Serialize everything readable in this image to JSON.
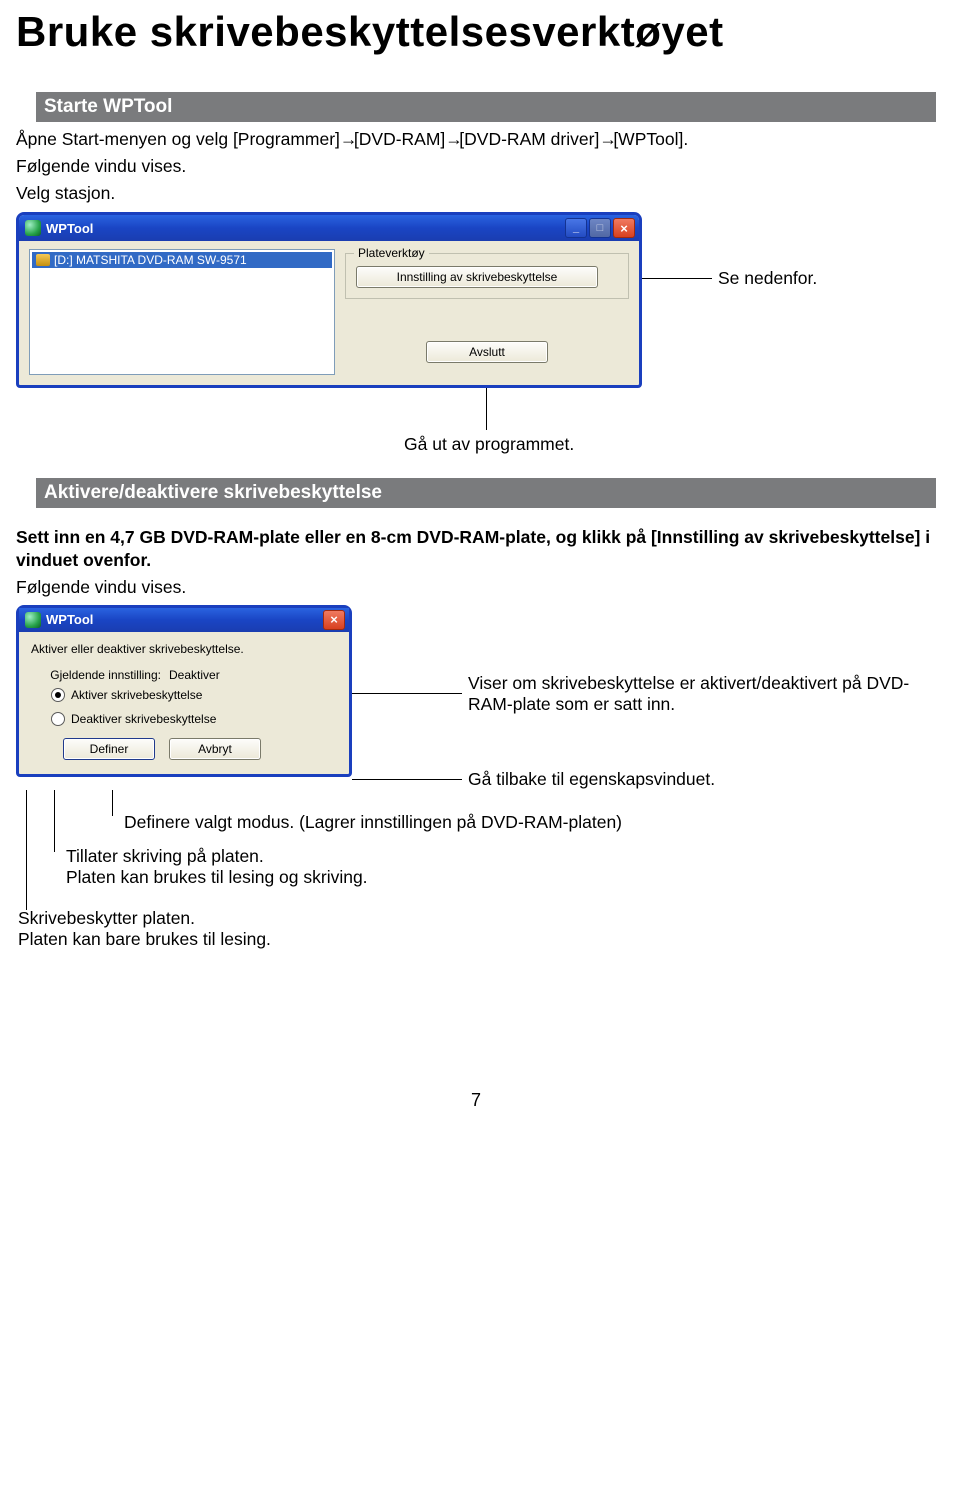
{
  "page_title": "Bruke skrivebeskyttelsesverktøyet",
  "section1_title": "Starte WPTool",
  "open_instructions_prefix": "Åpne Start-menyen og velg ",
  "open_path": [
    "[Programmer]",
    "[DVD-RAM]",
    "[DVD-RAM driver]",
    "[WPTool]"
  ],
  "arrow": "→",
  "period": ".",
  "following_window": "Følgende vindu vises.",
  "select_station": "Velg stasjon.",
  "win1": {
    "title": "WPTool",
    "drive_item": "[D:] MATSHITA DVD-RAM SW-9571",
    "group_label": "Plateverktøy",
    "btn_setting": "Innstilling av skrivebeskyttelse",
    "btn_quit": "Avslutt"
  },
  "callout_see_below": "Se nedenfor.",
  "callout_exit": "Gå ut av programmet.",
  "section2_title": "Aktivere/deaktivere skrivebeskyttelse",
  "section2_para": "Sett inn en 4,7 GB DVD-RAM-plate eller en 8-cm DVD-RAM-plate, og klikk på [Innstilling av skrivebeskyttelse] i vinduet ovenfor.",
  "win2": {
    "title": "WPTool",
    "desc": "Aktiver eller deaktiver skrivebeskyttelse.",
    "current_label": "Gjeldende innstilling:",
    "current_value": "Deaktiver",
    "radio_enable": "Aktiver skrivebeskyttelse",
    "radio_disable": "Deaktiver skrivebeskyttelse",
    "btn_define": "Definer",
    "btn_cancel": "Avbryt"
  },
  "callout_shows": "Viser om skrivebeskyttelse er aktivert/deaktivert på DVD-RAM-plate som er satt inn.",
  "callout_back": "Gå tilbake til egenskapsvinduet.",
  "callout_define": "Definere valgt modus. (Lagrer innstillingen på DVD-RAM-platen)",
  "callout_allow_write1": "Tillater skriving på platen.",
  "callout_allow_write2": "Platen kan brukes til lesing og skriving.",
  "callout_wp1": "Skrivebeskytter platen.",
  "callout_wp2": "Platen kan bare brukes til lesing.",
  "page_number": "7"
}
